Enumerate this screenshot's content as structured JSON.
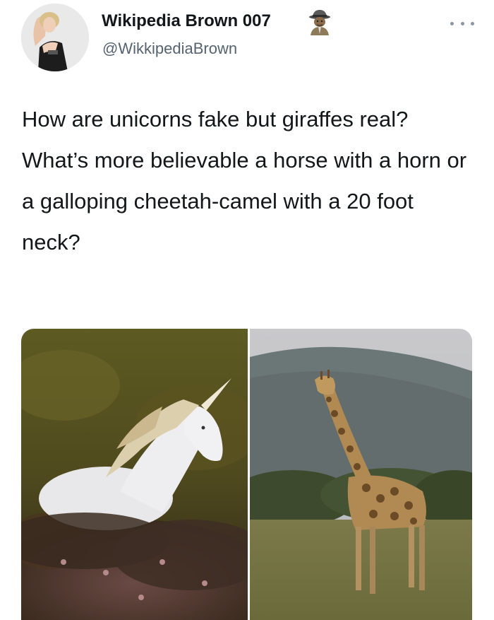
{
  "author": {
    "display_name": "Wikipedia Brown 007",
    "handle": "@WikkipediaBrown",
    "avatar_icon": "profile-photo",
    "badge_icon": "detective-emoji"
  },
  "menu": {
    "icon": "more-options-icon"
  },
  "tweet": {
    "paragraph_1": "How are unicorns fake but giraffes real?",
    "paragraph_2": "What’s more believable a horse with a horn or a galloping cheetah-camel with a 20 foot neck?"
  },
  "media": {
    "images": [
      {
        "name": "unicorn-photo",
        "subject": "unicorn"
      },
      {
        "name": "giraffe-photo",
        "subject": "giraffe"
      }
    ]
  },
  "colors": {
    "text_primary": "#14171a",
    "text_secondary": "#566370",
    "background": "#ffffff"
  }
}
